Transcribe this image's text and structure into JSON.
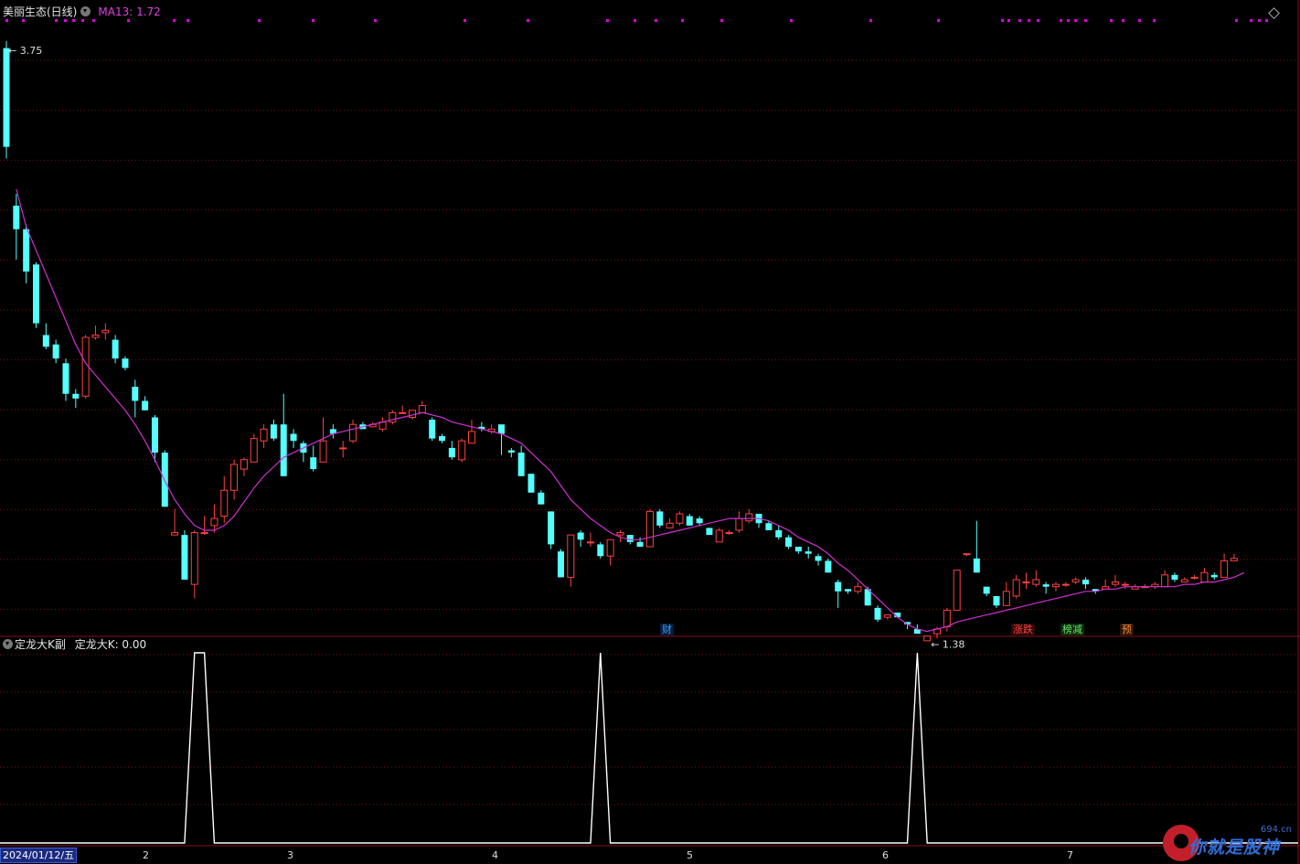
{
  "main_header": {
    "title": "美丽生态(日线)",
    "ma_label": "MA13: 1.72"
  },
  "sub_header": {
    "title": "定龙大K副",
    "value_label": "定龙大K: 0.00"
  },
  "annotations": {
    "high_label": "3.75",
    "low_label": "1.38"
  },
  "event_tags": [
    {
      "label": "财",
      "color": "#2fa0ff"
    },
    {
      "label": "涨跌",
      "color": "#ff4040"
    },
    {
      "label": "榜减",
      "color": "#6be36b"
    },
    {
      "label": "预",
      "color": "#ff8c3a"
    }
  ],
  "x_axis": {
    "start_date": "2024/01/12/五",
    "month_ticks": [
      "2",
      "3",
      "4",
      "5",
      "6",
      "7"
    ]
  },
  "watermark": {
    "site": "694.cn",
    "name": "你就是股神"
  },
  "colors": {
    "up": "#ff4040",
    "down": "#54ffff",
    "ma": "#d030d0",
    "indicator": "#ffffff",
    "grid": "#7a1010",
    "marker_dot": "#e000e0"
  },
  "chart_data": [
    {
      "type": "candlestick",
      "title": "美丽生态(日线)",
      "series_name": "MA13",
      "ylim": [
        1.32,
        3.8
      ],
      "candles": [
        [
          3.72,
          3.3,
          3.75,
          3.25
        ],
        [
          3.05,
          2.95,
          3.1,
          2.82
        ],
        [
          2.95,
          2.77,
          2.97,
          2.72
        ],
        [
          2.8,
          2.55,
          2.81,
          2.53
        ],
        [
          2.5,
          2.45,
          2.55,
          2.44
        ],
        [
          2.46,
          2.4,
          2.48,
          2.38
        ],
        [
          2.38,
          2.25,
          2.4,
          2.22
        ],
        [
          2.25,
          2.23,
          2.27,
          2.19
        ],
        [
          2.24,
          2.49,
          2.5,
          2.23
        ],
        [
          2.49,
          2.5,
          2.54,
          2.48
        ],
        [
          2.51,
          2.52,
          2.55,
          2.48
        ],
        [
          2.48,
          2.4,
          2.5,
          2.38
        ],
        [
          2.4,
          2.36,
          2.41,
          2.35
        ],
        [
          2.28,
          2.22,
          2.31,
          2.15
        ],
        [
          2.22,
          2.18,
          2.24,
          2.18
        ],
        [
          2.15,
          2.0,
          2.16,
          1.96
        ],
        [
          2.0,
          1.77,
          2.01,
          1.77
        ],
        [
          1.65,
          1.66,
          1.76,
          1.65
        ],
        [
          1.65,
          1.46,
          1.67,
          1.46
        ],
        [
          1.44,
          1.66,
          1.67,
          1.38
        ],
        [
          1.66,
          1.66,
          1.73,
          1.65
        ],
        [
          1.69,
          1.72,
          1.78,
          1.66
        ],
        [
          1.73,
          1.84,
          1.9,
          1.7
        ],
        [
          1.84,
          1.95,
          1.97,
          1.8
        ],
        [
          1.93,
          1.97,
          1.98,
          1.9
        ],
        [
          1.96,
          2.06,
          2.08,
          1.96
        ],
        [
          2.05,
          2.1,
          2.12,
          2.02
        ],
        [
          2.12,
          2.06,
          2.14,
          2.05
        ],
        [
          2.12,
          1.9,
          2.25,
          1.9
        ],
        [
          2.08,
          2.05,
          2.1,
          2.02
        ],
        [
          2.04,
          2.0,
          2.05,
          1.96
        ],
        [
          1.98,
          1.93,
          2.03,
          1.92
        ],
        [
          1.96,
          2.05,
          2.15,
          1.96
        ],
        [
          2.1,
          2.08,
          2.12,
          2.06
        ],
        [
          2.02,
          2.02,
          2.05,
          1.98
        ],
        [
          2.05,
          2.12,
          2.14,
          2.04
        ],
        [
          2.12,
          2.1,
          2.13,
          2.1
        ],
        [
          2.11,
          2.12,
          2.13,
          2.11
        ],
        [
          2.1,
          2.13,
          2.15,
          2.09
        ],
        [
          2.13,
          2.17,
          2.18,
          2.12
        ],
        [
          2.17,
          2.17,
          2.2,
          2.17
        ],
        [
          2.15,
          2.18,
          2.18,
          2.14
        ],
        [
          2.17,
          2.2,
          2.22,
          2.17
        ],
        [
          2.14,
          2.06,
          2.15,
          2.05
        ],
        [
          2.07,
          2.05,
          2.08,
          2.04
        ],
        [
          2.02,
          1.98,
          2.05,
          1.97
        ],
        [
          1.97,
          2.05,
          2.06,
          1.96
        ],
        [
          2.04,
          2.09,
          2.14,
          2.04
        ],
        [
          2.11,
          2.1,
          2.13,
          2.09
        ],
        [
          2.09,
          2.1,
          2.12,
          2.08
        ],
        [
          2.12,
          2.08,
          2.12,
          1.99
        ],
        [
          2.01,
          2.0,
          2.02,
          1.98
        ],
        [
          2.0,
          1.9,
          2.03,
          1.9
        ],
        [
          1.91,
          1.83,
          1.91,
          1.83
        ],
        [
          1.83,
          1.78,
          1.84,
          1.78
        ],
        [
          1.75,
          1.61,
          1.75,
          1.59
        ],
        [
          1.58,
          1.47,
          1.59,
          1.47
        ],
        [
          1.47,
          1.65,
          1.65,
          1.43
        ],
        [
          1.66,
          1.63,
          1.67,
          1.6
        ],
        [
          1.62,
          1.62,
          1.66,
          1.6
        ],
        [
          1.61,
          1.56,
          1.62,
          1.55
        ],
        [
          1.56,
          1.63,
          1.63,
          1.52
        ],
        [
          1.65,
          1.66,
          1.67,
          1.62
        ],
        [
          1.65,
          1.62,
          1.65,
          1.61
        ],
        [
          1.62,
          1.6,
          1.64,
          1.6
        ],
        [
          1.6,
          1.75,
          1.76,
          1.6
        ],
        [
          1.75,
          1.69,
          1.76,
          1.68
        ],
        [
          1.68,
          1.7,
          1.72,
          1.68
        ],
        [
          1.7,
          1.74,
          1.75,
          1.69
        ],
        [
          1.73,
          1.69,
          1.74,
          1.69
        ],
        [
          1.72,
          1.7,
          1.73,
          1.69
        ],
        [
          1.68,
          1.65,
          1.68,
          1.65
        ],
        [
          1.62,
          1.67,
          1.68,
          1.62
        ],
        [
          1.66,
          1.66,
          1.67,
          1.65
        ],
        [
          1.67,
          1.72,
          1.75,
          1.66
        ],
        [
          1.71,
          1.74,
          1.76,
          1.7
        ],
        [
          1.74,
          1.7,
          1.74,
          1.68
        ],
        [
          1.7,
          1.67,
          1.71,
          1.67
        ],
        [
          1.67,
          1.64,
          1.69,
          1.63
        ],
        [
          1.64,
          1.6,
          1.65,
          1.59
        ],
        [
          1.6,
          1.58,
          1.6,
          1.57
        ],
        [
          1.58,
          1.57,
          1.6,
          1.55
        ],
        [
          1.56,
          1.54,
          1.57,
          1.52
        ],
        [
          1.54,
          1.49,
          1.55,
          1.49
        ],
        [
          1.45,
          1.41,
          1.46,
          1.34
        ],
        [
          1.42,
          1.41,
          1.42,
          1.4
        ],
        [
          1.41,
          1.43,
          1.45,
          1.4
        ],
        [
          1.42,
          1.35,
          1.43,
          1.35
        ],
        [
          1.34,
          1.29,
          1.35,
          1.28
        ],
        [
          1.3,
          1.31,
          1.31,
          1.29
        ],
        [
          1.32,
          1.3,
          1.32,
          1.31
        ],
        [
          1.28,
          1.27,
          1.28,
          1.25
        ],
        [
          1.25,
          1.23,
          1.27,
          1.23
        ],
        [
          1.2,
          1.22,
          1.22,
          1.21
        ],
        [
          1.23,
          1.25,
          1.26,
          1.21
        ],
        [
          1.26,
          1.33,
          1.34,
          1.24
        ],
        [
          1.33,
          1.5,
          1.5,
          1.33
        ],
        [
          1.57,
          1.57,
          1.57,
          1.56
        ],
        [
          1.55,
          1.49,
          1.71,
          1.49
        ],
        [
          1.43,
          1.4,
          1.42,
          1.39
        ],
        [
          1.39,
          1.35,
          1.37,
          1.34
        ],
        [
          1.35,
          1.41,
          1.45,
          1.35
        ],
        [
          1.39,
          1.46,
          1.48,
          1.38
        ],
        [
          1.45,
          1.45,
          1.49,
          1.42
        ],
        [
          1.44,
          1.46,
          1.5,
          1.43
        ],
        [
          1.44,
          1.43,
          1.45,
          1.4
        ],
        [
          1.43,
          1.44,
          1.45,
          1.41
        ],
        [
          1.44,
          1.44,
          1.45,
          1.43
        ],
        [
          1.45,
          1.46,
          1.47,
          1.44
        ],
        [
          1.46,
          1.44,
          1.47,
          1.42
        ],
        [
          1.42,
          1.41,
          1.42,
          1.4
        ],
        [
          1.42,
          1.43,
          1.46,
          1.42
        ],
        [
          1.44,
          1.45,
          1.48,
          1.43
        ],
        [
          1.44,
          1.44,
          1.45,
          1.42
        ],
        [
          1.42,
          1.43,
          1.44,
          1.42
        ],
        [
          1.43,
          1.43,
          1.44,
          1.43
        ],
        [
          1.43,
          1.44,
          1.45,
          1.42
        ],
        [
          1.43,
          1.48,
          1.5,
          1.43
        ],
        [
          1.48,
          1.46,
          1.49,
          1.45
        ],
        [
          1.45,
          1.46,
          1.47,
          1.45
        ],
        [
          1.47,
          1.47,
          1.48,
          1.46
        ],
        [
          1.45,
          1.49,
          1.51,
          1.45
        ],
        [
          1.48,
          1.47,
          1.49,
          1.46
        ],
        [
          1.47,
          1.54,
          1.57,
          1.47
        ],
        [
          1.54,
          1.55,
          1.57,
          1.54
        ]
      ],
      "ma13": [
        null,
        3.12,
        2.96,
        2.86,
        2.76,
        2.66,
        2.56,
        2.46,
        2.38,
        2.33,
        2.28,
        2.23,
        2.18,
        2.12,
        2.05,
        1.97,
        1.88,
        1.8,
        1.74,
        1.69,
        1.67,
        1.67,
        1.69,
        1.73,
        1.79,
        1.85,
        1.9,
        1.94,
        1.98,
        2.0,
        2.02,
        2.04,
        2.06,
        2.08,
        2.09,
        2.1,
        2.11,
        2.12,
        2.13,
        2.14,
        2.15,
        2.16,
        2.17,
        2.16,
        2.15,
        2.13,
        2.12,
        2.11,
        2.1,
        2.09,
        2.08,
        2.06,
        2.04,
        2.0,
        1.96,
        1.92,
        1.86,
        1.8,
        1.76,
        1.72,
        1.69,
        1.66,
        1.64,
        1.63,
        1.63,
        1.64,
        1.65,
        1.66,
        1.67,
        1.68,
        1.69,
        1.7,
        1.71,
        1.72,
        1.72,
        1.72,
        1.72,
        1.71,
        1.69,
        1.67,
        1.64,
        1.62,
        1.6,
        1.57,
        1.53,
        1.5,
        1.46,
        1.42,
        1.38,
        1.34,
        1.3,
        1.27,
        1.25,
        1.24,
        1.25,
        1.26,
        1.28,
        1.29,
        1.3,
        1.31,
        1.32,
        1.33,
        1.34,
        1.35,
        1.36,
        1.37,
        1.38,
        1.39,
        1.4,
        1.41,
        1.41,
        1.42,
        1.42,
        1.43,
        1.43,
        1.43,
        1.43,
        1.43,
        1.43,
        1.44,
        1.44,
        1.45,
        1.45,
        1.46,
        1.47,
        1.49
      ]
    },
    {
      "type": "line",
      "title": "定龙大K副",
      "series_name": "定龙大K",
      "ylim": [
        0,
        1
      ],
      "x": [
        0,
        18,
        19,
        20,
        21,
        59,
        60,
        61,
        91,
        92,
        93,
        126
      ],
      "values": [
        0,
        0,
        1,
        1,
        0,
        0,
        1,
        0,
        0,
        1,
        0,
        0
      ]
    }
  ]
}
